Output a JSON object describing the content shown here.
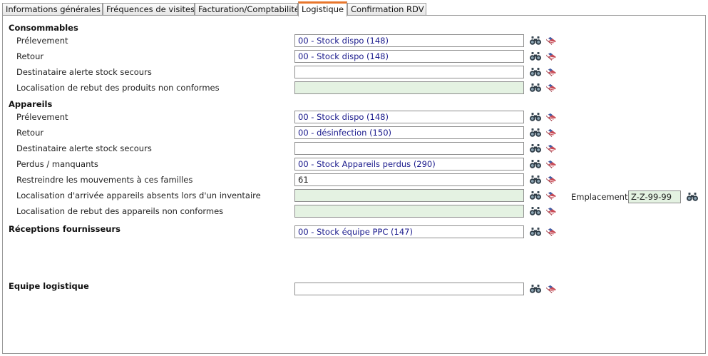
{
  "tabs": [
    {
      "label": "Informations générales"
    },
    {
      "label": "Fréquences de visites"
    },
    {
      "label": "Facturation/Comptabilité"
    },
    {
      "label": "Logistique"
    },
    {
      "label": "Confirmation RDV"
    }
  ],
  "consommables": {
    "title": "Consommables",
    "rows": [
      {
        "label": "Prélevement",
        "value": "00 - Stock dispo (148)"
      },
      {
        "label": "Retour",
        "value": "00 - Stock dispo (148)"
      },
      {
        "label": "Destinataire alerte stock secours",
        "value": ""
      },
      {
        "label": "Localisation de rebut des produits non conformes",
        "value": ""
      }
    ]
  },
  "appareils": {
    "title": "Appareils",
    "rows": [
      {
        "label": "Prélevement",
        "value": "00 - Stock dispo (148)"
      },
      {
        "label": "Retour",
        "value": "00 - désinfection (150)"
      },
      {
        "label": "Destinataire alerte stock secours",
        "value": ""
      },
      {
        "label": "Perdus / manquants",
        "value": "00 - Stock Appareils perdus (290)"
      },
      {
        "label": "Restreindre les mouvements à ces familles",
        "value": "61"
      },
      {
        "label": "Localisation d'arrivée appareils absents lors d'un inventaire",
        "value": ""
      },
      {
        "label": "Localisation de rebut des appareils non conformes",
        "value": ""
      }
    ]
  },
  "emplacement": {
    "label": "Emplacement",
    "value": "Z-Z-99-99"
  },
  "receptions": {
    "title": "Réceptions fournisseurs",
    "value": "00 - Stock équipe PPC (147)"
  },
  "equipe": {
    "title": "Equipe logistique",
    "value": ""
  },
  "icons": {
    "search": "binoculars-icon",
    "clear": "eraser-icon"
  },
  "colors": {
    "active_tab_accent": "#e8762c",
    "readonly_field": "#e4f2e2",
    "field_text": "#1a1a8c"
  }
}
